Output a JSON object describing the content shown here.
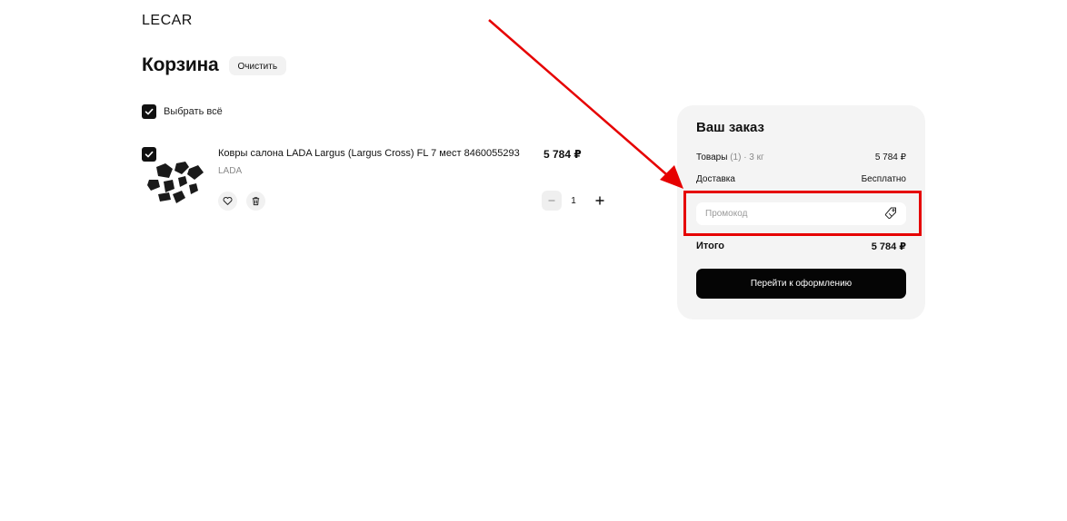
{
  "header": {
    "logo_text": "LECAR"
  },
  "cart": {
    "title": "Корзина",
    "clear_label": "Очистить",
    "select_all_label": "Выбрать всё",
    "items": [
      {
        "name": "Ковры салона LADA Largus (Largus Cross) FL 7 мест 8460055293",
        "brand": "LADA",
        "price": "5 784 ₽",
        "quantity": "1",
        "checked": true
      }
    ]
  },
  "order": {
    "title": "Ваш заказ",
    "goods_label": "Товары",
    "goods_count": "(1)",
    "goods_weight": "· 3 кг",
    "goods_price": "5 784 ₽",
    "delivery_label": "Доставка",
    "delivery_value": "Бесплатно",
    "promo_placeholder": "Промокод",
    "total_label": "Итого",
    "total_value": "5 784 ₽",
    "checkout_label": "Перейти к оформлению"
  },
  "annotation": {
    "color": "#e60000"
  },
  "icons": [
    "check-icon",
    "heart-icon",
    "trash-icon",
    "minus-icon",
    "plus-icon",
    "tag-icon"
  ]
}
